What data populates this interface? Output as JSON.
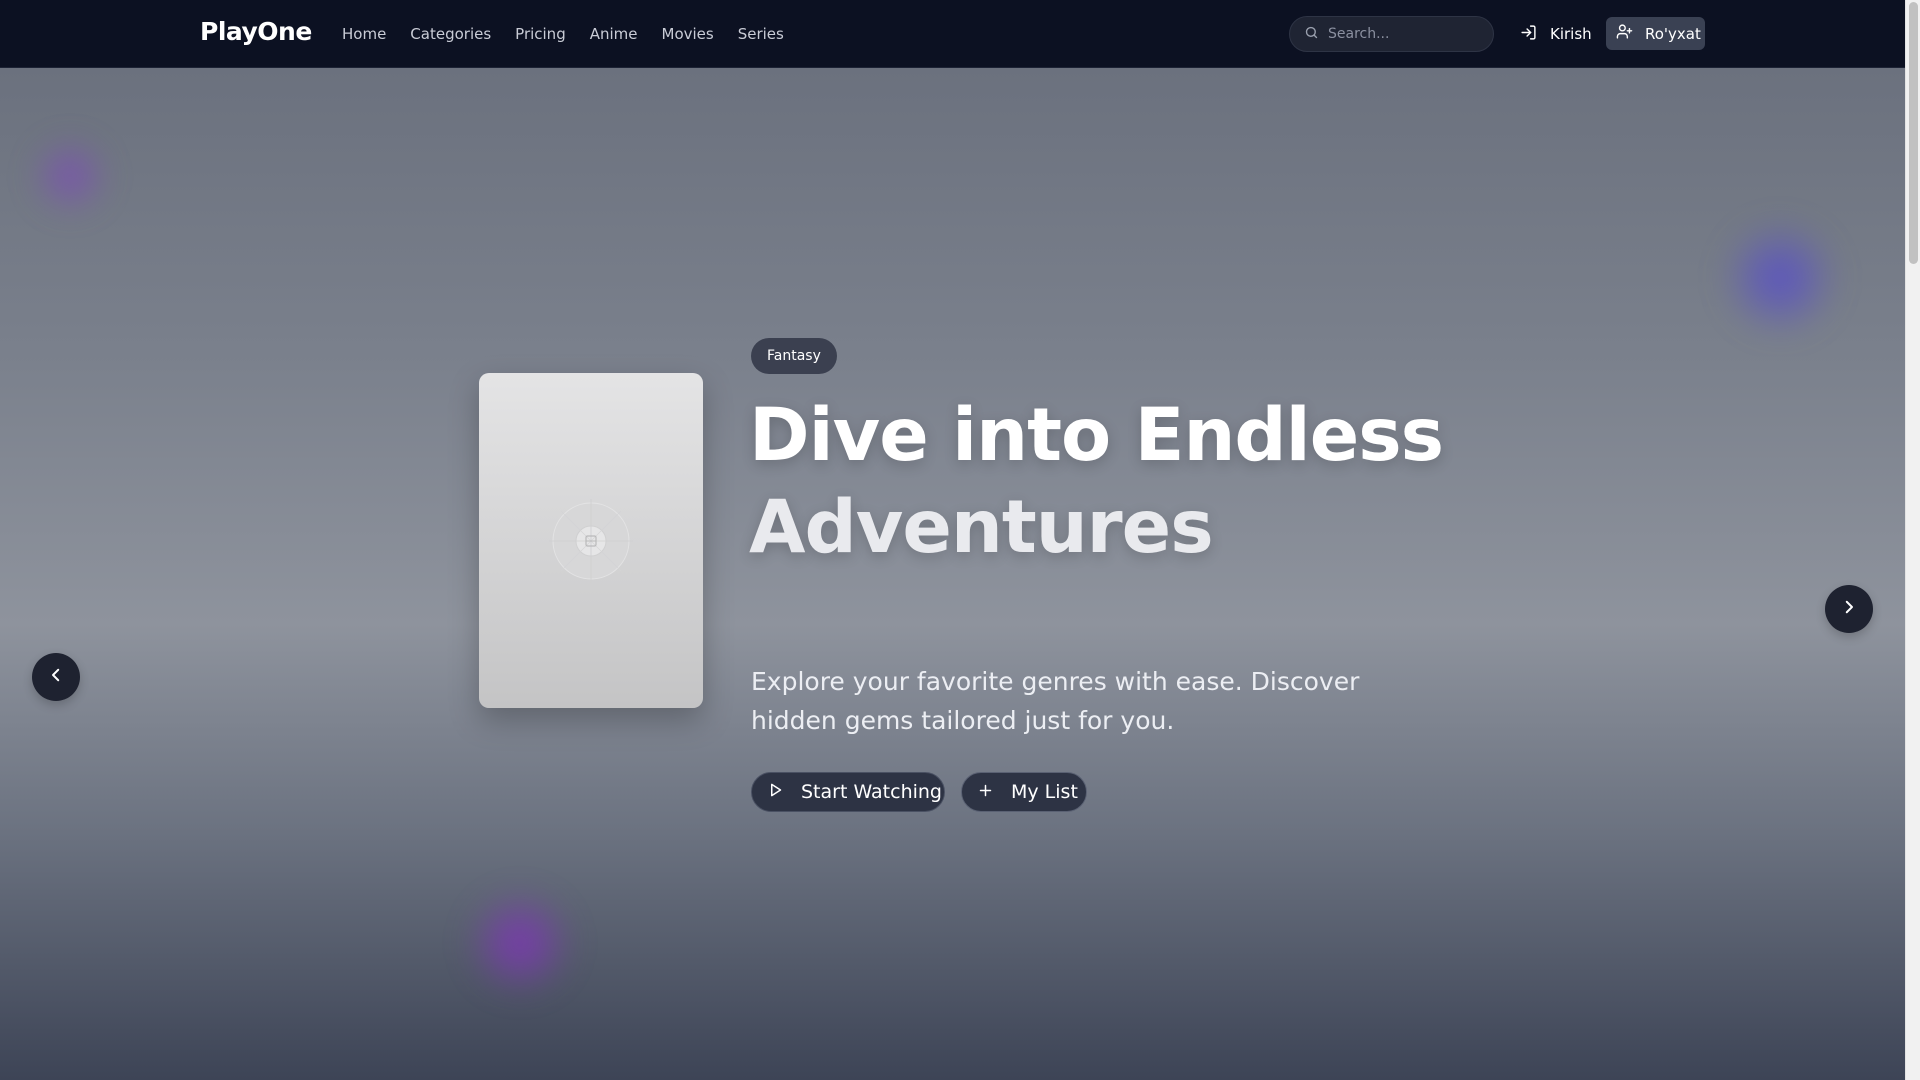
{
  "header": {
    "logo": "PlayOne",
    "nav": [
      "Home",
      "Categories",
      "Pricing",
      "Anime",
      "Movies",
      "Series"
    ],
    "search_placeholder": "Search...",
    "login_label": "Kirish",
    "register_label": "Ro'yxat"
  },
  "hero": {
    "genre_badge": "Fantasy",
    "title_line1": "Dive into Endless",
    "title_line2": "Adventures",
    "description": "Explore your favorite genres with ease. Discover hidden gems tailored just for you.",
    "primary_button": "Start Watching",
    "secondary_button": "My List"
  },
  "icons": {
    "search": "search-icon",
    "login": "log-in-icon",
    "register": "user-plus-icon",
    "play": "play-icon",
    "plus": "plus-icon",
    "prev": "chevron-left-icon",
    "next": "chevron-right-icon",
    "poster_placeholder": "image-placeholder-icon"
  },
  "colors": {
    "header_bg": "#0c1122",
    "accent_glow_purple": "#7d46be",
    "accent_glow_indigo": "#554bcd",
    "button_bg": "#2d3344"
  }
}
